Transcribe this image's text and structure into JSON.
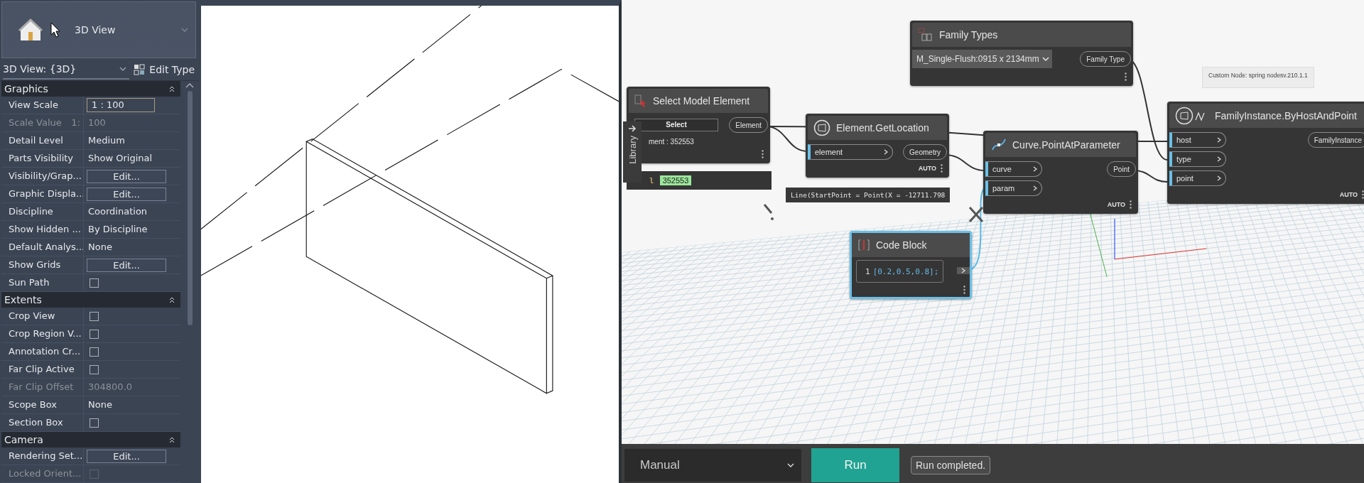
{
  "type_selector": {
    "label": "3D View"
  },
  "properties": {
    "view": "3D View: {3D}",
    "edit_type": "Edit Type",
    "sections": [
      {
        "title": "Graphics",
        "rows": [
          {
            "name": "View Scale",
            "kind": "field",
            "value": "1 : 100",
            "disabled": false
          },
          {
            "name": "Scale Value",
            "kind": "text",
            "prefix": "1:",
            "value": "100",
            "disabled": true
          },
          {
            "name": "Detail Level",
            "kind": "text",
            "value": "Medium",
            "disabled": false
          },
          {
            "name": "Parts Visibility",
            "kind": "text",
            "value": "Show Original",
            "disabled": false
          },
          {
            "name": "Visibility/Grap...",
            "kind": "button",
            "value": "Edit...",
            "disabled": false
          },
          {
            "name": "Graphic Displa...",
            "kind": "button",
            "value": "Edit...",
            "disabled": false
          },
          {
            "name": "Discipline",
            "kind": "text",
            "value": "Coordination",
            "disabled": false
          },
          {
            "name": "Show Hidden ...",
            "kind": "text",
            "value": "By Discipline",
            "disabled": false
          },
          {
            "name": "Default Analys...",
            "kind": "text",
            "value": "None",
            "disabled": false
          },
          {
            "name": "Show Grids",
            "kind": "button",
            "value": "Edit...",
            "disabled": false
          },
          {
            "name": "Sun Path",
            "kind": "checkbox",
            "checked": false,
            "disabled": false
          }
        ]
      },
      {
        "title": "Extents",
        "rows": [
          {
            "name": "Crop View",
            "kind": "checkbox",
            "checked": false,
            "disabled": false
          },
          {
            "name": "Crop Region V...",
            "kind": "checkbox",
            "checked": false,
            "disabled": false
          },
          {
            "name": "Annotation Cr...",
            "kind": "checkbox",
            "checked": false,
            "disabled": false
          },
          {
            "name": "Far Clip Active",
            "kind": "checkbox",
            "checked": false,
            "disabled": false
          },
          {
            "name": "Far Clip Offset",
            "kind": "text",
            "value": "304800.0",
            "disabled": true
          },
          {
            "name": "Scope Box",
            "kind": "text",
            "value": "None",
            "disabled": false
          },
          {
            "name": "Section Box",
            "kind": "checkbox",
            "checked": false,
            "disabled": false
          }
        ]
      },
      {
        "title": "Camera",
        "rows": [
          {
            "name": "Rendering Set...",
            "kind": "button",
            "value": "Edit...",
            "disabled": false
          },
          {
            "name": "Locked Orient...",
            "kind": "checkbox",
            "checked": false,
            "disabled": true
          }
        ]
      }
    ]
  },
  "library": {
    "label": "Library"
  },
  "nodes": [
    {
      "kind": "dropdown",
      "title": "Family Types",
      "selected": false,
      "value": "M_Single-Flush:0915 x 2134mm",
      "outputs": [
        "Family Type"
      ]
    },
    {
      "kind": "select",
      "title": "Select Model Element",
      "selected": false,
      "button": "Select",
      "info": "ment : 352553",
      "outputs": [
        "Element"
      ],
      "watch": {
        "label": "l",
        "value": "352553"
      }
    },
    {
      "kind": "function",
      "title": "Element.GetLocation",
      "selected": false,
      "inputs": [
        "element"
      ],
      "outputs": [
        "Geometry"
      ],
      "lacing": "AUTO"
    },
    {
      "kind": "function",
      "title": "Curve.PointAtParameter",
      "selected": false,
      "inputs": [
        "curve",
        "param"
      ],
      "outputs": [
        "Point"
      ],
      "lacing": "AUTO"
    },
    {
      "kind": "custom",
      "title": "FamilyInstance.ByHostAndPoint",
      "selected": false,
      "inputs": [
        "host",
        "type",
        "point"
      ],
      "outputs": [
        "FamilyInstance"
      ],
      "lacing": "AUTO"
    },
    {
      "kind": "code",
      "title": "Code Block",
      "selected": true,
      "line": "1",
      "code": "[0.2,0.5,0.8];"
    }
  ],
  "preview": "Line(StartPoint = Point(X = -12711.798",
  "tooltip": "Custom Node: spring nodesv.210.1.1",
  "run_bar": {
    "mode": "Manual",
    "run": "Run",
    "status": "Run completed."
  }
}
